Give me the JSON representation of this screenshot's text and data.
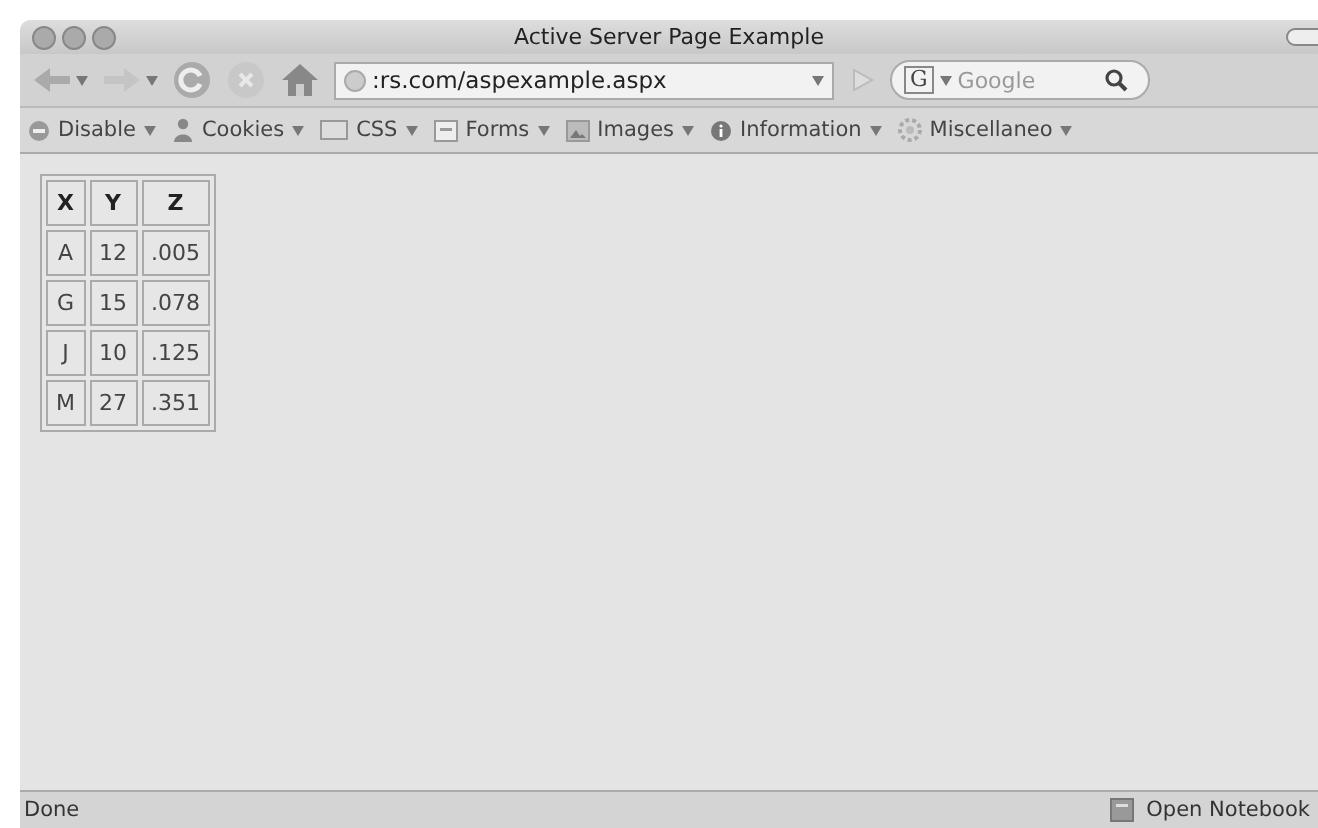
{
  "window": {
    "title": "Active Server Page Example"
  },
  "toolbar": {
    "address": ":rs.com/aspexample.aspx",
    "search_engine": "G",
    "search": {
      "placeholder": "Google"
    }
  },
  "bookmarks": [
    {
      "label": "Disable"
    },
    {
      "label": "Cookies"
    },
    {
      "label": "CSS"
    },
    {
      "label": "Forms"
    },
    {
      "label": "Images"
    },
    {
      "label": "Information"
    },
    {
      "label": "Miscellaneo"
    }
  ],
  "table": {
    "columns": [
      "X",
      "Y",
      "Z"
    ],
    "rows": [
      [
        "A",
        "12",
        ".005"
      ],
      [
        "G",
        "15",
        ".078"
      ],
      [
        "J",
        "10",
        ".125"
      ],
      [
        "M",
        "27",
        ".351"
      ]
    ]
  },
  "status_bar": {
    "text": "Done",
    "notebook": "Open Notebook"
  }
}
